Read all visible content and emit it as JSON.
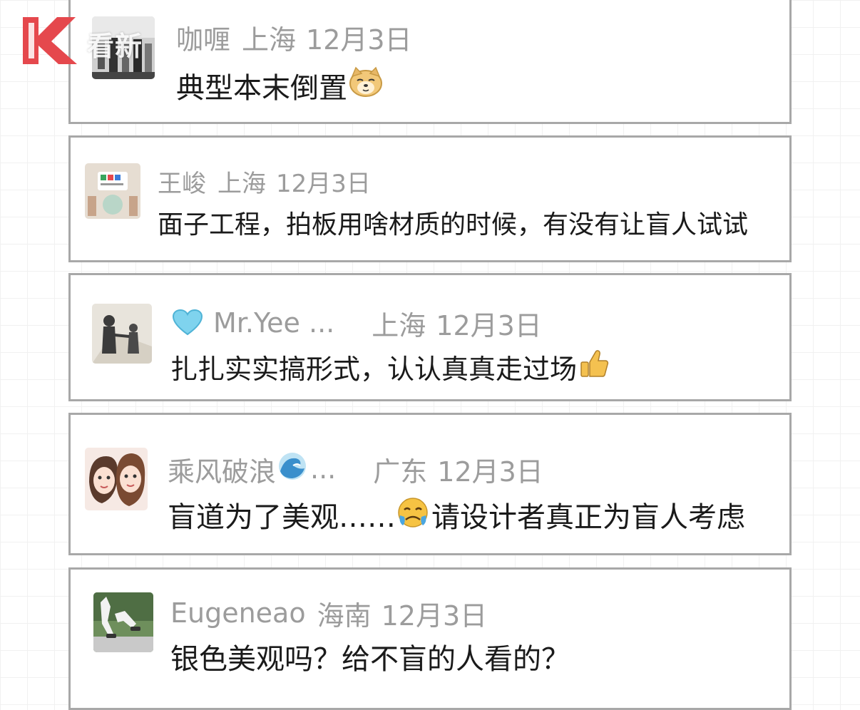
{
  "watermark": {
    "text": "看新",
    "logo": "k-logo-icon",
    "color": "#e5484d"
  },
  "comments": [
    {
      "username": "咖喱",
      "location": "上海",
      "date": "12月3日",
      "text": "典型本末倒置",
      "emoji": "doge-emoji"
    },
    {
      "username": "王峻",
      "location": "上海",
      "date": "12月3日",
      "text": "面子工程，拍板用啥材质的时候，有没有让盲人试试"
    },
    {
      "badge": "heart-icon",
      "username": "Mr.Yee ...",
      "location": "上海",
      "date": "12月3日",
      "text": "扎扎实实搞形式，认认真真走过场",
      "emoji": "thumbs-up-emoji"
    },
    {
      "username": "乘风破浪",
      "username_suffix": "...",
      "username_emoji": "wave-emoji",
      "location": "广东",
      "date": "12月3日",
      "text": "盲道为了美观……",
      "text_emoji": "crying-emoji",
      "text_after": "请设计者真正为盲人考虑"
    },
    {
      "username": "Eugeneao",
      "location": "海南",
      "date": "12月3日",
      "text": "银色美观吗？给不盲的人看的？"
    }
  ]
}
